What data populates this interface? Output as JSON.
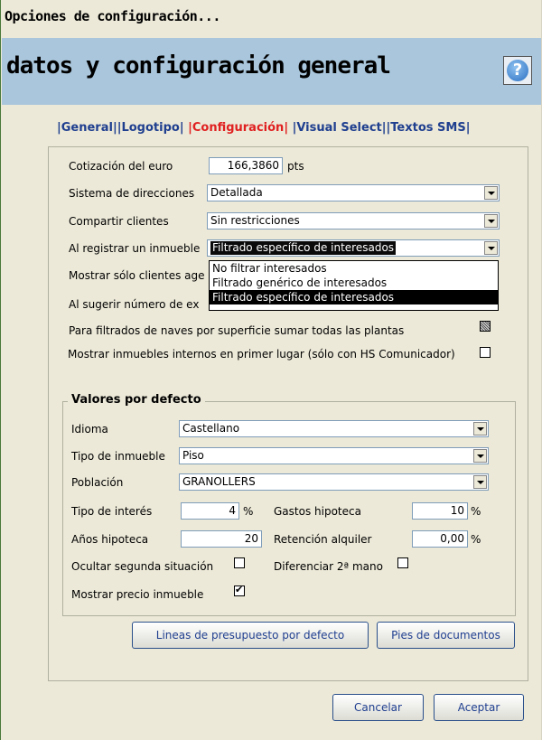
{
  "window": {
    "title": "Opciones de configuración..."
  },
  "header": {
    "title": "datos y configuración general",
    "help_glyph": "?"
  },
  "tabs": [
    {
      "label": "General"
    },
    {
      "label": "Logotipo"
    },
    {
      "label": "Configuración"
    },
    {
      "label": "Visual Select"
    },
    {
      "label": "Textos SMS"
    }
  ],
  "config": {
    "cotizacion_label": "Cotización del euro",
    "cotizacion_value": "166,3860",
    "cotizacion_unit": "pts",
    "sistema_label": "Sistema de direcciones",
    "sistema_value": "Detallada",
    "compartir_label": "Compartir clientes",
    "compartir_value": "Sin restricciones",
    "registrar_label": "Al registrar un inmueble",
    "registrar_value": "Filtrado específico de interesados",
    "mostrar_label": "Mostrar sólo clientes age",
    "sugerir_label": "Al sugerir número de ex",
    "naves_label": "Para filtrados de naves por superficie sumar todas las plantas",
    "internos_label": "Mostrar inmuebles internos en primer lugar (sólo con HS Comunicador)",
    "dropdown_options": [
      "No filtrar interesados",
      "Filtrado genérico de interesados",
      "Filtrado específico de interesados"
    ]
  },
  "defaults": {
    "title": "Valores por defecto",
    "idioma_label": "Idioma",
    "idioma_value": "Castellano",
    "tipo_label": "Tipo de inmueble",
    "tipo_value": "Piso",
    "poblacion_label": "Población",
    "poblacion_value": "GRANOLLERS",
    "interes_label": "Tipo de interés",
    "interes_value": "4",
    "interes_unit": "%",
    "gastos_label": "Gastos hipoteca",
    "gastos_value": "10",
    "gastos_unit": "%",
    "anos_label": "Años hipoteca",
    "anos_value": "20",
    "retencion_label": "Retención alquiler",
    "retencion_value": "0,00",
    "retencion_unit": "%",
    "ocultar_label": "Ocultar segunda situación",
    "diferenciar_label": "Diferenciar 2ª mano",
    "precio_label": "Mostrar precio inmueble"
  },
  "buttons": {
    "lineas": "Lineas de presupuesto por defecto",
    "pies": "Pies de documentos",
    "cancelar": "Cancelar",
    "aceptar": "Aceptar"
  },
  "colors": {
    "header_bg": "#a9c6dc",
    "active_tab": "#e02020",
    "tab": "#1f3f8f"
  }
}
